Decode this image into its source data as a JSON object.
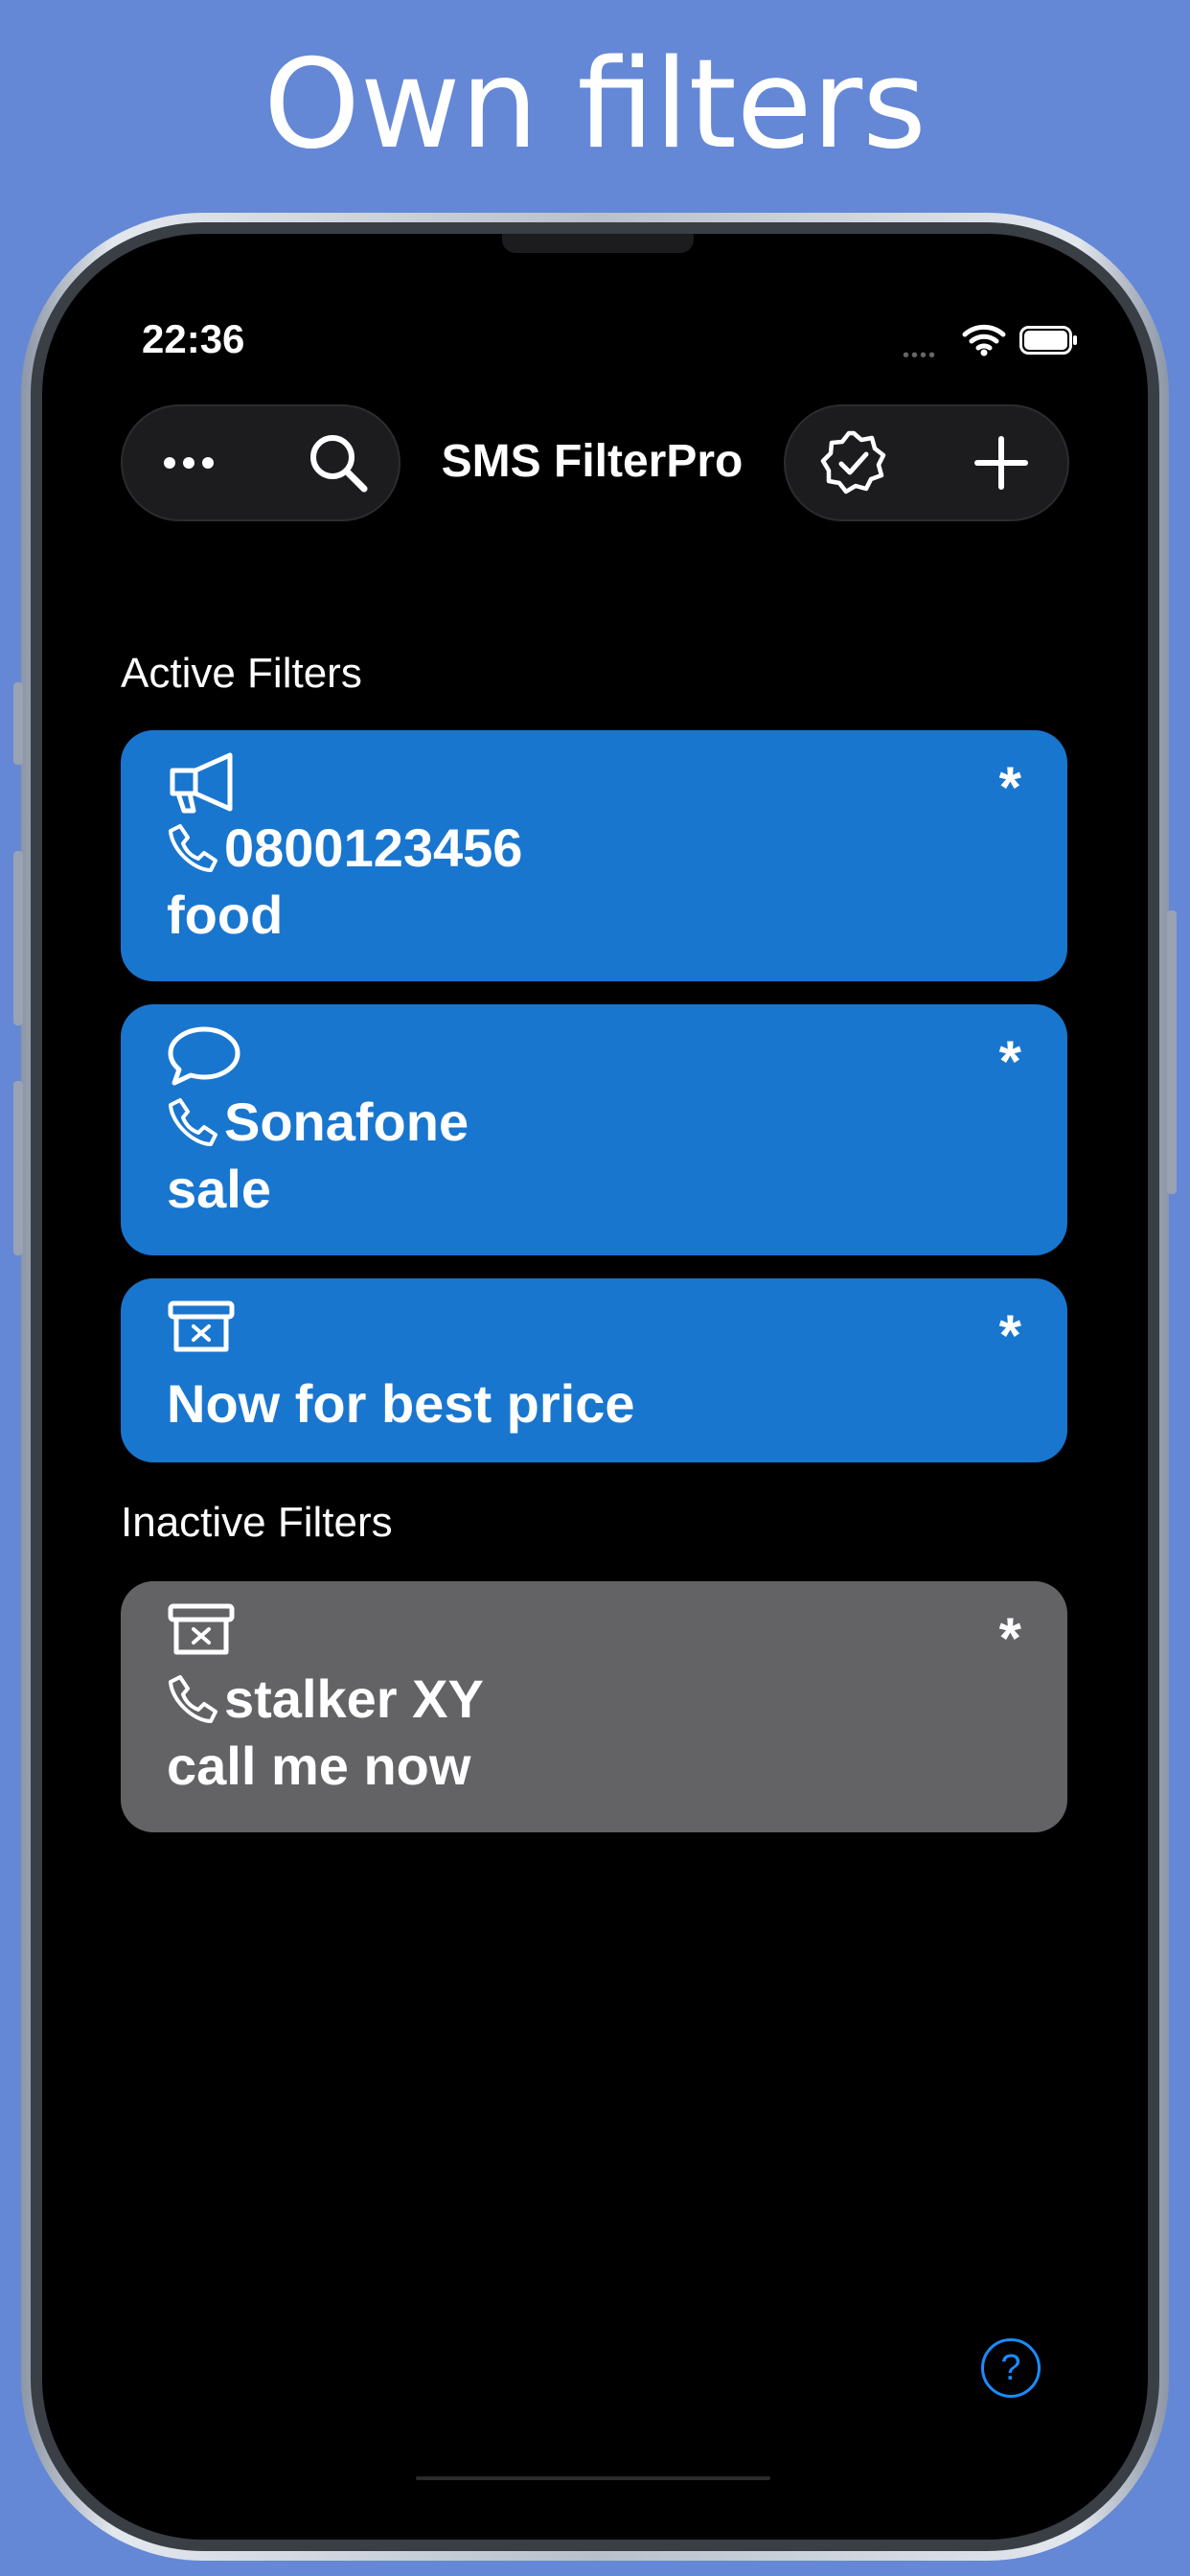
{
  "headline": "Own filters",
  "status_bar": {
    "time": "22:36",
    "signal": "••••"
  },
  "nav": {
    "title": "SMS FilterPro",
    "more_icon": "ellipsis-icon",
    "search_icon": "search-icon",
    "verified_icon": "checkmark-seal-icon",
    "add_icon": "plus-icon"
  },
  "sections": {
    "active_label": "Active Filters",
    "inactive_label": "Inactive Filters"
  },
  "filters": [
    {
      "icon": "megaphone-icon",
      "star": "*",
      "sender": "0800123456",
      "text": "food",
      "status": "active"
    },
    {
      "icon": "message-bubble-icon",
      "star": "*",
      "sender": "Sonafone",
      "text": "sale",
      "status": "active"
    },
    {
      "icon": "trash-box-icon",
      "star": "*",
      "text": "Now for best price",
      "status": "active"
    },
    {
      "icon": "trash-box-icon",
      "star": "*",
      "sender": "stalker XY",
      "text": "call me now",
      "status": "inactive"
    }
  ],
  "help": {
    "label": "?"
  },
  "colors": {
    "background": "#6488d6",
    "active_card": "#1976cf",
    "inactive_card": "#636366",
    "help": "#1a8cff"
  }
}
